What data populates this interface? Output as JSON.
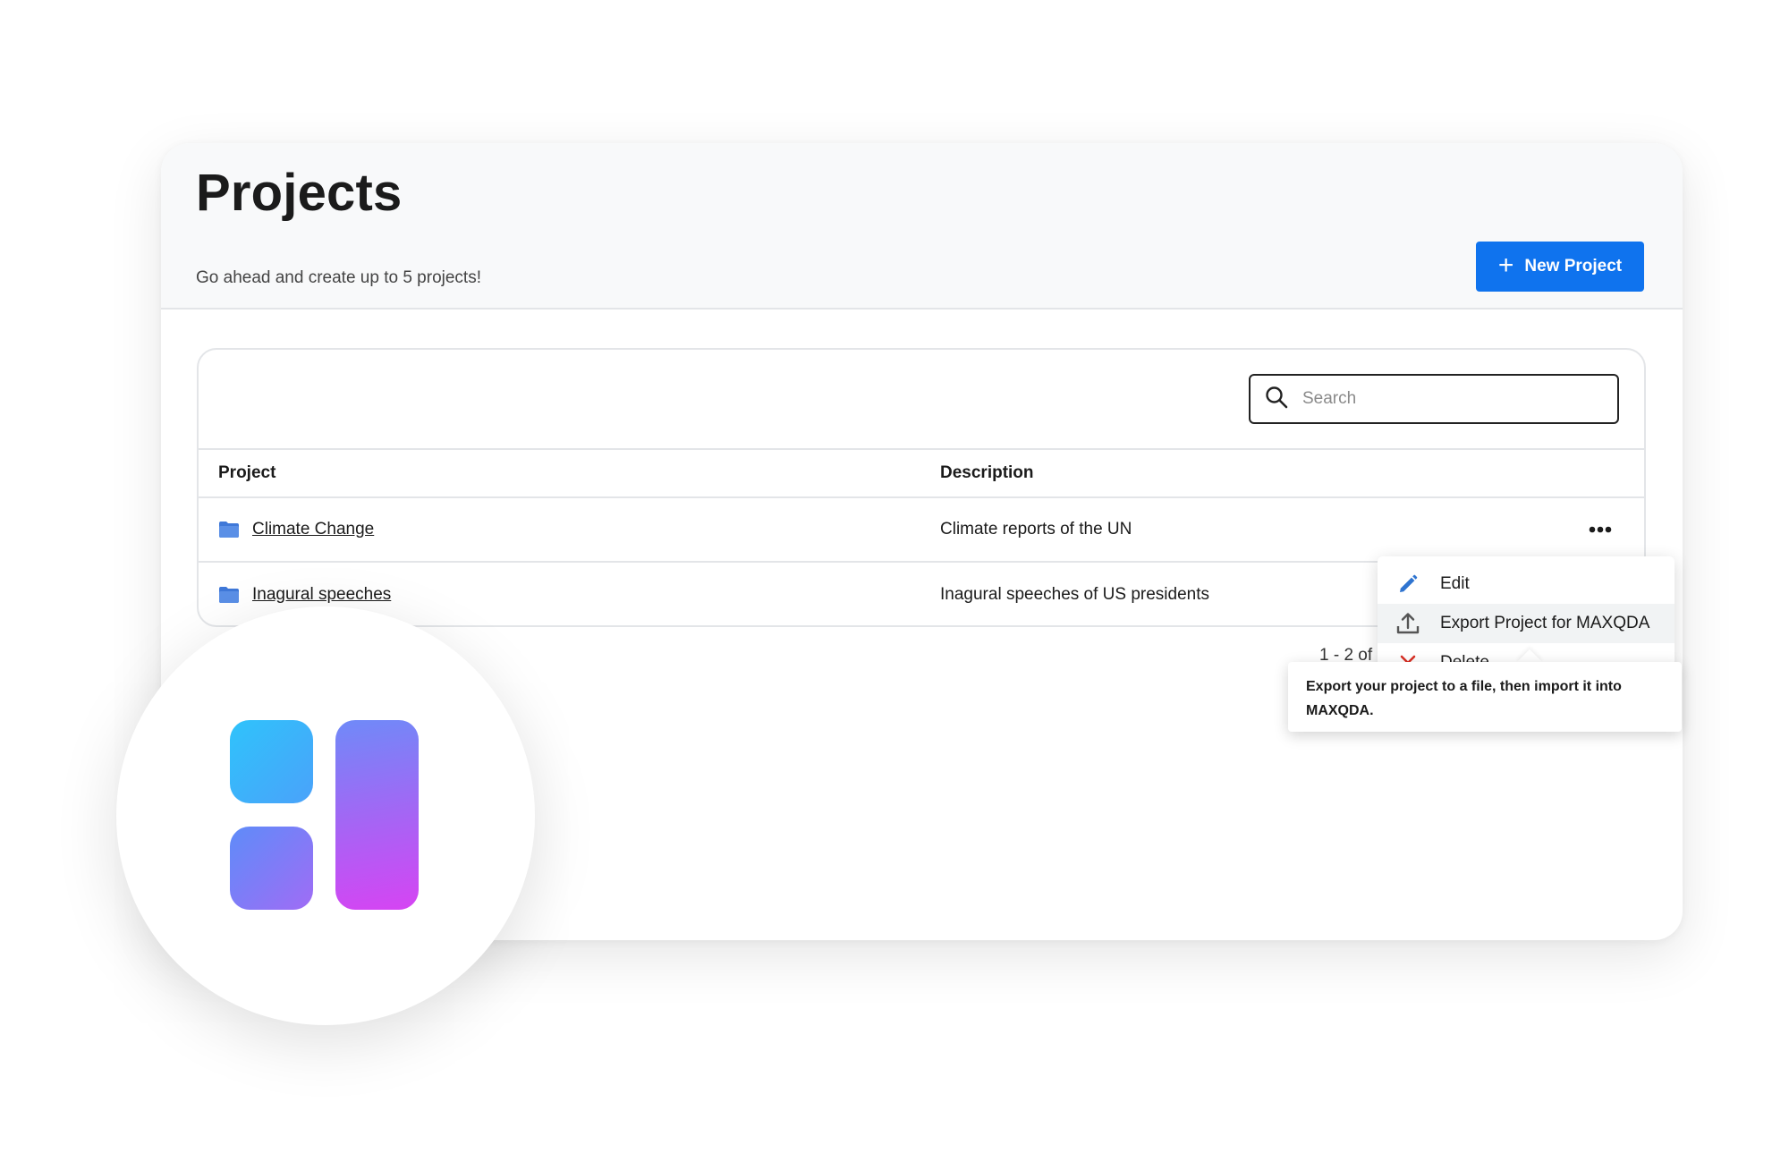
{
  "header": {
    "title": "Projects",
    "subtitle": "Go ahead and create up to 5 projects!",
    "new_project_label": "New Project"
  },
  "search": {
    "placeholder": "Search",
    "value": ""
  },
  "table": {
    "columns": [
      "Project",
      "Description"
    ],
    "rows": [
      {
        "name": "Climate Change",
        "description": "Climate reports of the UN"
      },
      {
        "name": "Inagural speeches",
        "description": "Inagural speeches of US presidents"
      }
    ]
  },
  "pagination": {
    "label": "1 - 2 of"
  },
  "context_menu": {
    "items": [
      {
        "label": "Edit",
        "icon": "pencil-icon"
      },
      {
        "label": "Export Project for MAXQDA",
        "icon": "upload-icon"
      },
      {
        "label": "Delete",
        "icon": "close-icon"
      }
    ]
  },
  "tooltip": {
    "text": "Export your project to a file, then import it into MAXQDA."
  },
  "colors": {
    "accent": "#0f73ee",
    "folder": "#3f78d8",
    "delete": "#d93025",
    "edit_icon": "#2f74d0"
  }
}
